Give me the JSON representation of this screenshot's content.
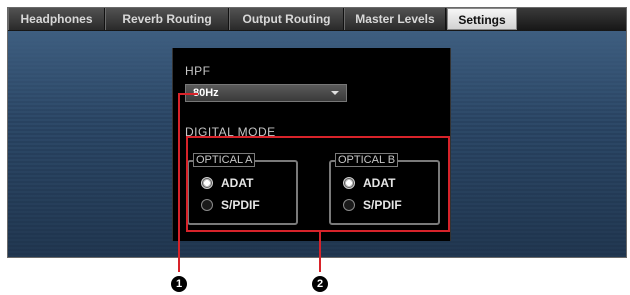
{
  "tabs": [
    {
      "label": "Headphones",
      "active": false
    },
    {
      "label": "Reverb Routing",
      "active": false
    },
    {
      "label": "Output Routing",
      "active": false
    },
    {
      "label": "Master Levels",
      "active": false
    },
    {
      "label": "Settings",
      "active": true
    }
  ],
  "hpf": {
    "label": "HPF",
    "value": "80Hz"
  },
  "digital_mode": {
    "label": "DIGITAL MODE",
    "groups": [
      {
        "title": "OPTICAL A",
        "options": [
          {
            "label": "ADAT",
            "selected": true
          },
          {
            "label": "S/PDIF",
            "selected": false
          }
        ]
      },
      {
        "title": "OPTICAL B",
        "options": [
          {
            "label": "ADAT",
            "selected": true
          },
          {
            "label": "S/PDIF",
            "selected": false
          }
        ]
      }
    ]
  },
  "callouts": [
    "1",
    "2"
  ],
  "colors": {
    "highlight": "#d8232a",
    "panel_bg": "#000000",
    "content_bg": "#2d4968"
  }
}
